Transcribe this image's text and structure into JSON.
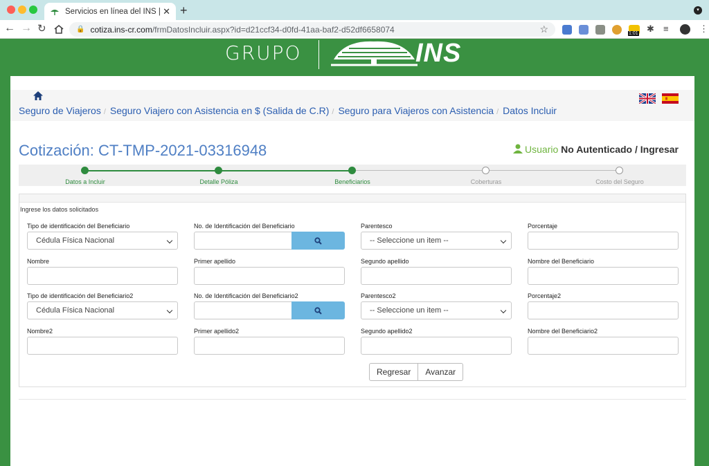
{
  "browser": {
    "tab_title": "Servicios en línea del INS | Cot",
    "url_host": "cotiza.ins-cr.com",
    "url_path": "/frmDatosIncluir.aspx?id=d21ccf34-d0fd-41aa-baf2-d52df6658074",
    "extension_badge": "1:01"
  },
  "header": {
    "logo_left": "GRUPO",
    "logo_right": "INS"
  },
  "breadcrumb": {
    "items": [
      "Seguro de Viajeros",
      "Seguro Viajero con Asistencia en $ (Salida de C.R)",
      "Seguro para Viajeros con Asistencia",
      "Datos Incluir"
    ]
  },
  "quote": {
    "title": "Cotización: CT-TMP-2021-03316948",
    "user_label": "Usuario",
    "user_status": "No Autenticado / Ingresar"
  },
  "steps": [
    {
      "label": "Datos a Incluir",
      "done": true
    },
    {
      "label": "Detalle Póliza",
      "done": true
    },
    {
      "label": "Beneficiarios",
      "done": true
    },
    {
      "label": "Coberturas",
      "done": false
    },
    {
      "label": "Costo del Seguro",
      "done": false
    }
  ],
  "form": {
    "instructions": "Ingrese los datos solicitados",
    "row1": {
      "tipo_label": "Tipo de identificación del Beneficiario",
      "tipo_value": "Cédula Física Nacional",
      "numid_label": "No. de Identificación del Beneficiario",
      "numid_value": "",
      "parentesco_label": "Parentesco",
      "parentesco_value": "-- Seleccione un item --",
      "porcentaje_label": "Porcentaje",
      "porcentaje_value": ""
    },
    "row2": {
      "nombre_label": "Nombre",
      "apellido1_label": "Primer apellido",
      "apellido2_label": "Segundo apellido",
      "nombre_benef_label": "Nombre del Beneficiario"
    },
    "row3": {
      "tipo_label": "Tipo de identificación del Beneficiario2",
      "tipo_value": "Cédula Física Nacional",
      "numid_label": "No. de Identificación del Beneficiario2",
      "numid_value": "",
      "parentesco_label": "Parentesco2",
      "parentesco_value": "-- Seleccione un item --",
      "porcentaje_label": "Porcentaje2",
      "porcentaje_value": ""
    },
    "row4": {
      "nombre_label": "Nombre2",
      "apellido1_label": "Primer apellido2",
      "apellido2_label": "Segundo apellido2",
      "nombre_benef_label": "Nombre del Beneficiario2"
    },
    "buttons": {
      "back": "Regresar",
      "next": "Avanzar"
    }
  },
  "colors": {
    "page_green": "#3a9142",
    "step_done": "#2e8b3e",
    "link_blue": "#2a5db0",
    "title_blue": "#4f7fc4",
    "search_button": "#6cb6e0"
  }
}
